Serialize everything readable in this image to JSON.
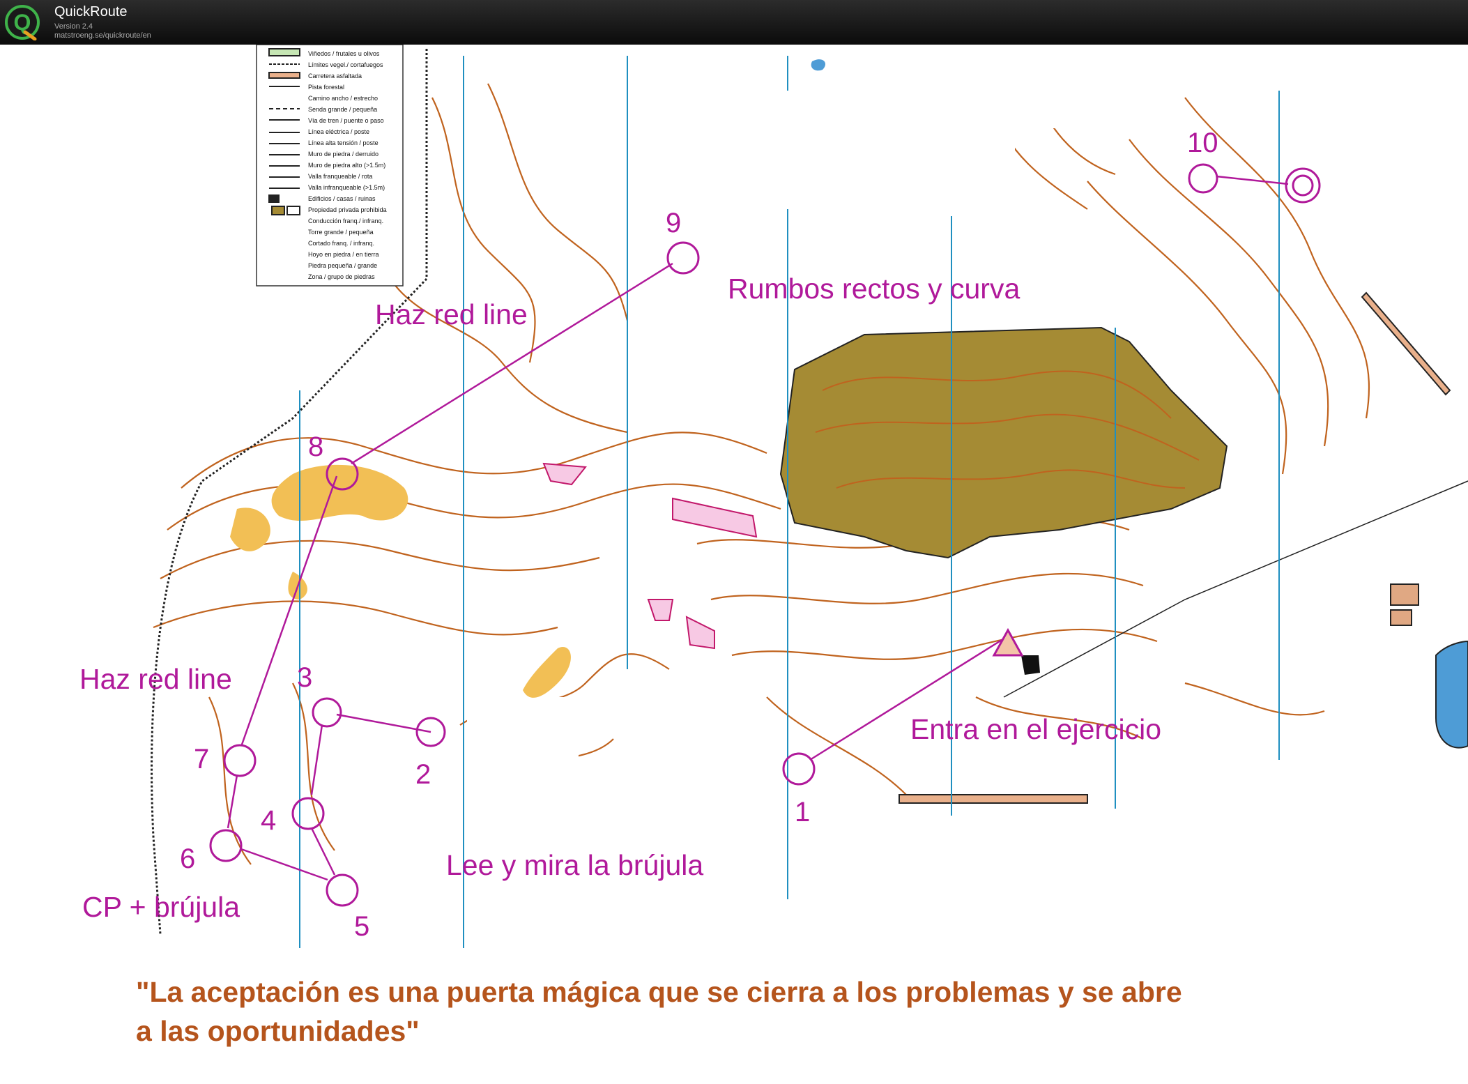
{
  "app": {
    "name": "QuickRoute",
    "version": "Version 2.4",
    "url": "matstroeng.se/quickroute/en",
    "logo_letter": "Q"
  },
  "colors": {
    "route": "#b0199a",
    "contour": "#c0631e",
    "quote": "#b5541c",
    "forbidden_area": "#a58b34",
    "meridian": "#1f8fc0",
    "water": "#4e9cd6"
  },
  "legend": {
    "items": [
      "Viñedos / frutales u olivos",
      "Límites vegel./ cortafuegos",
      "Carretera asfaltada",
      "Pista forestal",
      "Camino  ancho / estrecho",
      "Senda grande  / pequeña",
      "Vía de tren / puente o paso",
      "Línea eléctrica / poste",
      "Línea alta tensión / poste",
      "Muro de piedra / derruido",
      "Muro de piedra alto (>1.5m)",
      "Valla franqueable / rota",
      "Valla infranqueable (>1.5m)",
      "Edificios / casas / ruinas",
      "Propiedad privada prohibida",
      "Conducción franq./ infranq.",
      "Torre grande / pequeña",
      "Cortado franq. / infranq.",
      "Hoyo en piedra / en tierra",
      "Piedra pequeña / grande",
      "Zona / grupo de piedras"
    ]
  },
  "controls": {
    "start": "",
    "c1": "1",
    "c2": "2",
    "c3": "3",
    "c4": "4",
    "c5": "5",
    "c6": "6",
    "c7": "7",
    "c8": "8",
    "c9": "9",
    "c10": "10"
  },
  "annotations": {
    "rumbos": "Rumbos rectos y curva",
    "haz_red_line_1": "Haz red line",
    "haz_red_line_2": "Haz red line",
    "entra": "Entra en el ejercicio",
    "lee": "Lee y mira la brújula",
    "cp": "CP + brújula"
  },
  "quote": {
    "line1": "\"La aceptación es una puerta mágica que se cierra a los problemas y se abre",
    "line2": "a las oportunidades\""
  }
}
